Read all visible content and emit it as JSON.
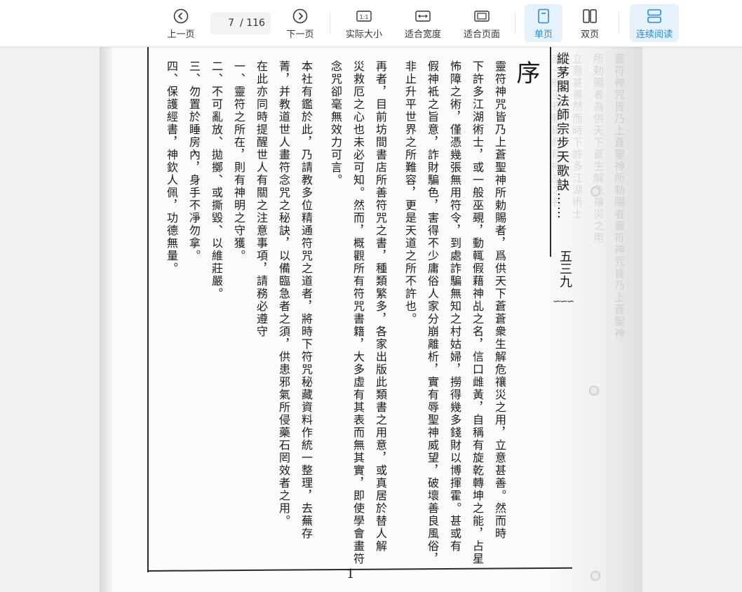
{
  "toolbar": {
    "prev_label": "上一页",
    "page_current": "7",
    "page_total": "/ 116",
    "next_label": "下一页",
    "actual_size_label": "实际大小",
    "fit_width_label": "适合宽度",
    "fit_page_label": "适合页面",
    "single_page_label": "单页",
    "double_page_label": "双页",
    "continuous_label": "连续阅读",
    "accent_color": "#2a8ad6"
  },
  "document": {
    "header": "縱茅閣法師宗步天歌訣",
    "header_page_number": "五三九",
    "header_dots": "……",
    "title": "序",
    "paragraphs": [
      "靈符神咒皆乃上蒼聖神所勅賜者，爲供天下蒼蒼衆生解危禳災之用，立意甚善。然而時",
      "下許多江湖術士，或一般巫覡，動輒假藉神乩之名，信口雌黃，自稱有旋乾轉坤之能，占星",
      "怖障之術，僅憑幾張無用符令，到處詐騙無知之村姑婦，撈得幾多錢財以博揮霍。甚或有",
      "假神袛之旨意，詐財騙色，害得不少庸俗人家分崩離析，實有辱聖神威望，破壞善良風俗，",
      "非止升平世界之所難容，更是天道之所不許也。",
      "再者，目前坊間書店所善符咒之書，種類繁多，各家出版此類書之用意，或真居於替人解",
      "災救厄之心也未必可知。然而，概觀所有符咒書籍，大多虛有其表而無其實，即使學會畫符",
      "念咒卻毫無效力可言。",
      "本社有鑑於此，乃請教多位精通符咒之道者，將時下符咒秘藏資料作統一整理，去蕪存",
      "菁，并教道世人畫符念咒之秘訣，以備臨急者之須，供患邪氣所侵藥石罔效者之用。",
      "在此亦同時提醒世人有關之注意事項，請務必遵守",
      "一、靈符之所在，則有神明之守獲。",
      "二、不可亂放、拋擲、或撕毀、以維莊嚴。",
      "三、勿置於睡房內，身手不凈勿拿。",
      "四、保護經書，神欽人佩，功德無量。"
    ],
    "footer_page_number": "1"
  }
}
